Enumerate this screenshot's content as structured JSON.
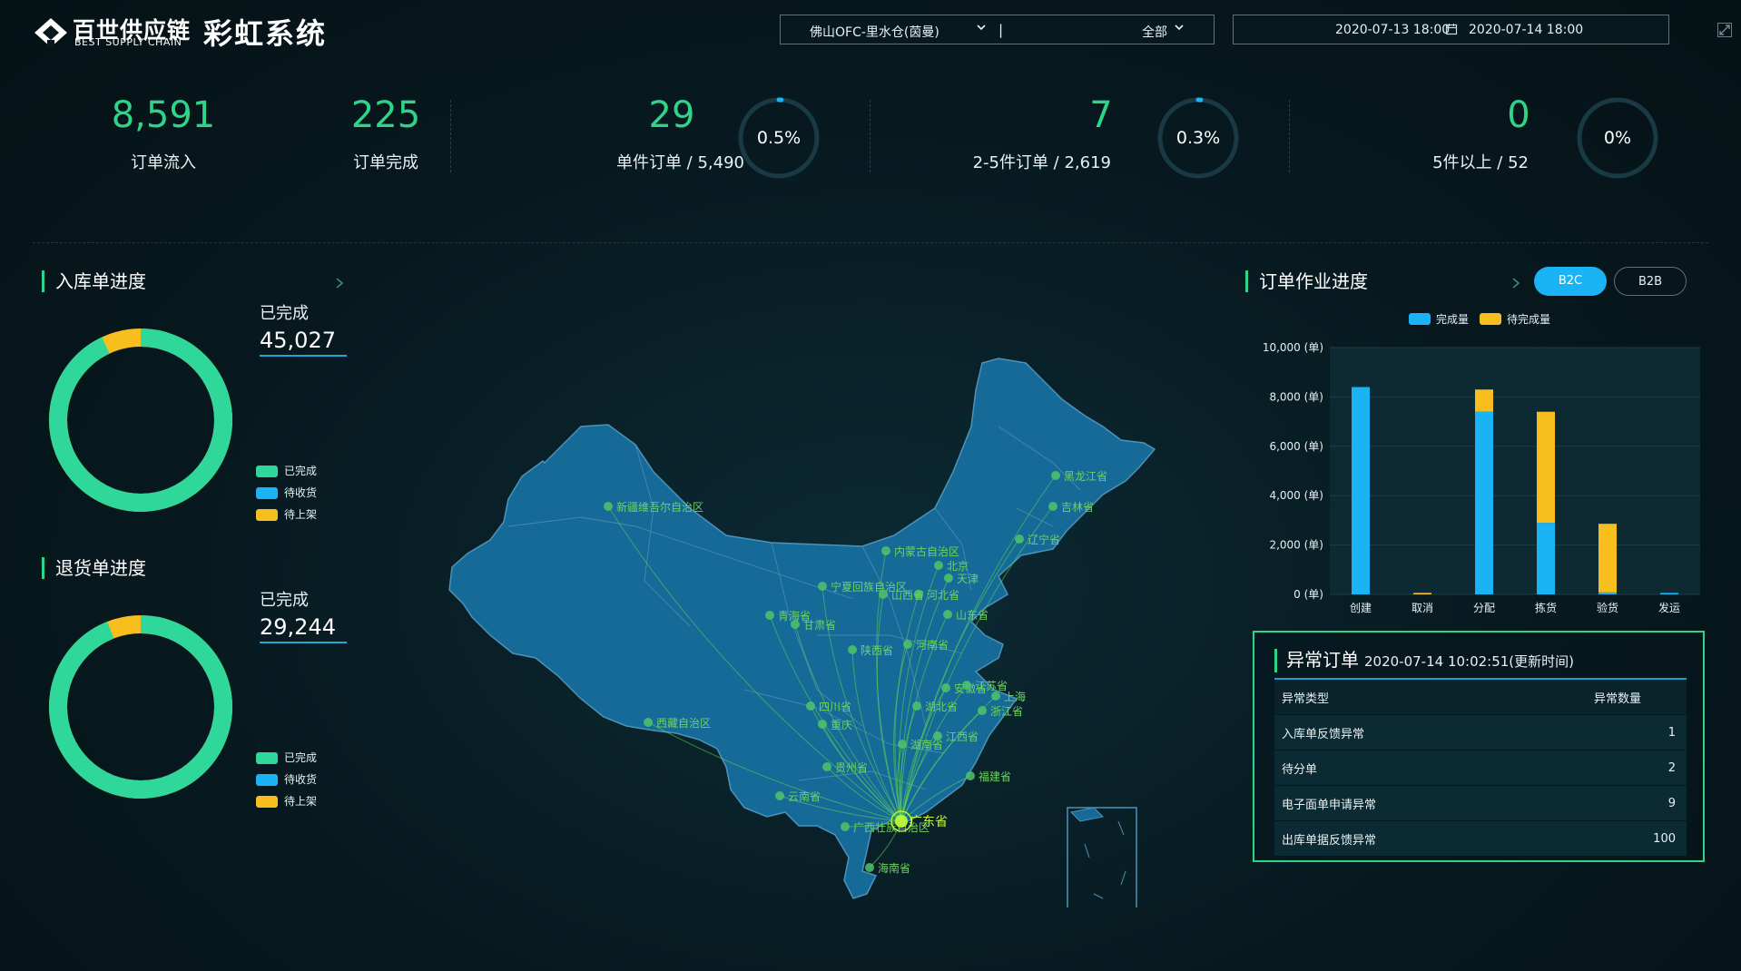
{
  "header": {
    "brand_cn": "百世供应链",
    "brand_en": "BEST SUPPLY CHAIN",
    "system_title": "彩虹系统",
    "warehouse_select": "佛山OFC-里水仓(茵曼)",
    "separator": "|",
    "category_select": "全部",
    "date_start": "2020-07-13 18:00",
    "date_end": "2020-07-14 18:00"
  },
  "kpis": {
    "order_in": {
      "value": "8,591",
      "label": "订单流入"
    },
    "order_done": {
      "value": "225",
      "label": "订单完成"
    },
    "single": {
      "value": "29",
      "label": "单件订单 / 5,490",
      "percent_text": "0.5%",
      "percent": 0.5
    },
    "two_five": {
      "value": "7",
      "label": "2-5件订单 / 2,619",
      "percent_text": "0.3%",
      "percent": 0.3
    },
    "five_plus": {
      "value": "0",
      "label": "5件以上 / 52",
      "percent_text": "0%",
      "percent": 0
    }
  },
  "inbound": {
    "title": "入库单进度",
    "done_label": "已完成",
    "done_value": "45,027",
    "completed_ratio": 0.93,
    "legend": [
      {
        "name": "已完成",
        "color": "#2fd89a"
      },
      {
        "name": "待收货",
        "color": "#1ab3f5"
      },
      {
        "name": "待上架",
        "color": "#f7be1e"
      }
    ]
  },
  "returns": {
    "title": "退货单进度",
    "done_label": "已完成",
    "done_value": "29,244",
    "completed_ratio": 0.94,
    "legend": [
      {
        "name": "已完成",
        "color": "#2fd89a"
      },
      {
        "name": "待收货",
        "color": "#1ab3f5"
      },
      {
        "name": "待上架",
        "color": "#f7be1e"
      }
    ]
  },
  "map": {
    "hub": "广东省",
    "provinces": [
      {
        "name": "黑龙江省"
      },
      {
        "name": "吉林省"
      },
      {
        "name": "辽宁省"
      },
      {
        "name": "新疆维吾尔自治区"
      },
      {
        "name": "内蒙古自治区"
      },
      {
        "name": "北京"
      },
      {
        "name": "天津"
      },
      {
        "name": "宁夏回族自治区"
      },
      {
        "name": "河北省"
      },
      {
        "name": "山西省"
      },
      {
        "name": "山东省"
      },
      {
        "name": "青海省"
      },
      {
        "name": "甘肃省"
      },
      {
        "name": "陕西省"
      },
      {
        "name": "河南省"
      },
      {
        "name": "安徽省"
      },
      {
        "name": "江苏省"
      },
      {
        "name": "上海"
      },
      {
        "name": "浙江省"
      },
      {
        "name": "湖北省"
      },
      {
        "name": "四川省"
      },
      {
        "name": "西藏自治区"
      },
      {
        "name": "重庆"
      },
      {
        "name": "湖南省"
      },
      {
        "name": "江西省"
      },
      {
        "name": "贵州省"
      },
      {
        "name": "福建省"
      },
      {
        "name": "云南省"
      },
      {
        "name": "广西壮族自治区"
      },
      {
        "name": "广东省"
      },
      {
        "name": "海南省"
      }
    ]
  },
  "order_progress": {
    "title": "订单作业进度",
    "tabs": [
      "B2C",
      "B2B"
    ],
    "active_tab": "B2C"
  },
  "chart_data": {
    "type": "bar",
    "stacked": true,
    "categories": [
      "创建",
      "取消",
      "分配",
      "拣货",
      "验货",
      "发运"
    ],
    "series": [
      {
        "name": "完成量",
        "color": "#1ab3f5",
        "values": [
          8400,
          0,
          7400,
          2900,
          80,
          60
        ]
      },
      {
        "name": "待完成量",
        "color": "#f7be1e",
        "values": [
          0,
          60,
          900,
          4500,
          2780,
          0
        ]
      }
    ],
    "ylim": [
      0,
      10000
    ],
    "yticks": [
      "0 (单)",
      "2,000 (单)",
      "4,000 (单)",
      "6,000 (单)",
      "8,000 (单)",
      "10,000 (单)"
    ],
    "legend_position": "top-center"
  },
  "anomaly": {
    "title": "异常订单",
    "updated": "2020-07-14 10:02:51(更新时间)",
    "col_type": "异常类型",
    "col_count": "异常数量",
    "rows": [
      {
        "type": "入库单反馈异常",
        "count": "1"
      },
      {
        "type": "待分单",
        "count": "2"
      },
      {
        "type": "电子面单申请异常",
        "count": "9"
      },
      {
        "type": "出库单据反馈异常",
        "count": "100"
      }
    ]
  }
}
